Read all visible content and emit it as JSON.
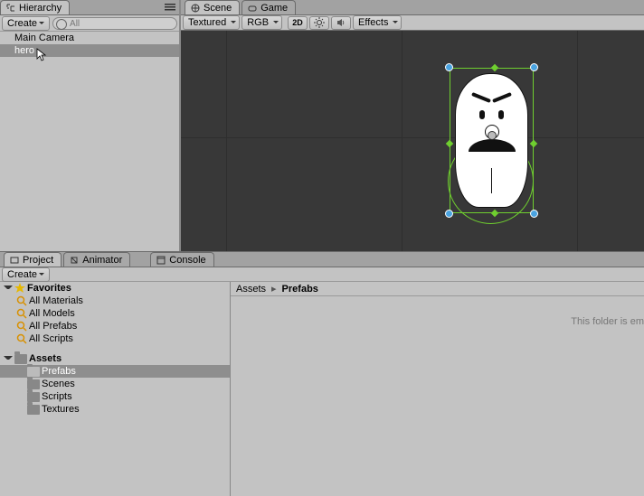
{
  "hierarchy": {
    "tab_label": "Hierarchy",
    "create_label": "Create",
    "search_placeholder": "All",
    "items": [
      "Main Camera",
      "hero"
    ],
    "selected_index": 1
  },
  "scene": {
    "tab_scene": "Scene",
    "tab_game": "Game",
    "shading": "Textured",
    "render_mode": "RGB",
    "mode_2d": "2D",
    "effects_label": "Effects"
  },
  "project": {
    "tab_project": "Project",
    "tab_animator": "Animator",
    "tab_console": "Console",
    "create_label": "Create",
    "favorites_label": "Favorites",
    "favorites": [
      "All Materials",
      "All Models",
      "All Prefabs",
      "All Scripts"
    ],
    "assets_label": "Assets",
    "folders": [
      "Prefabs",
      "Scenes",
      "Scripts",
      "Textures"
    ],
    "selected_folder": "Prefabs",
    "breadcrumb": [
      "Assets",
      "Prefabs"
    ],
    "empty_text": "This folder is em"
  }
}
